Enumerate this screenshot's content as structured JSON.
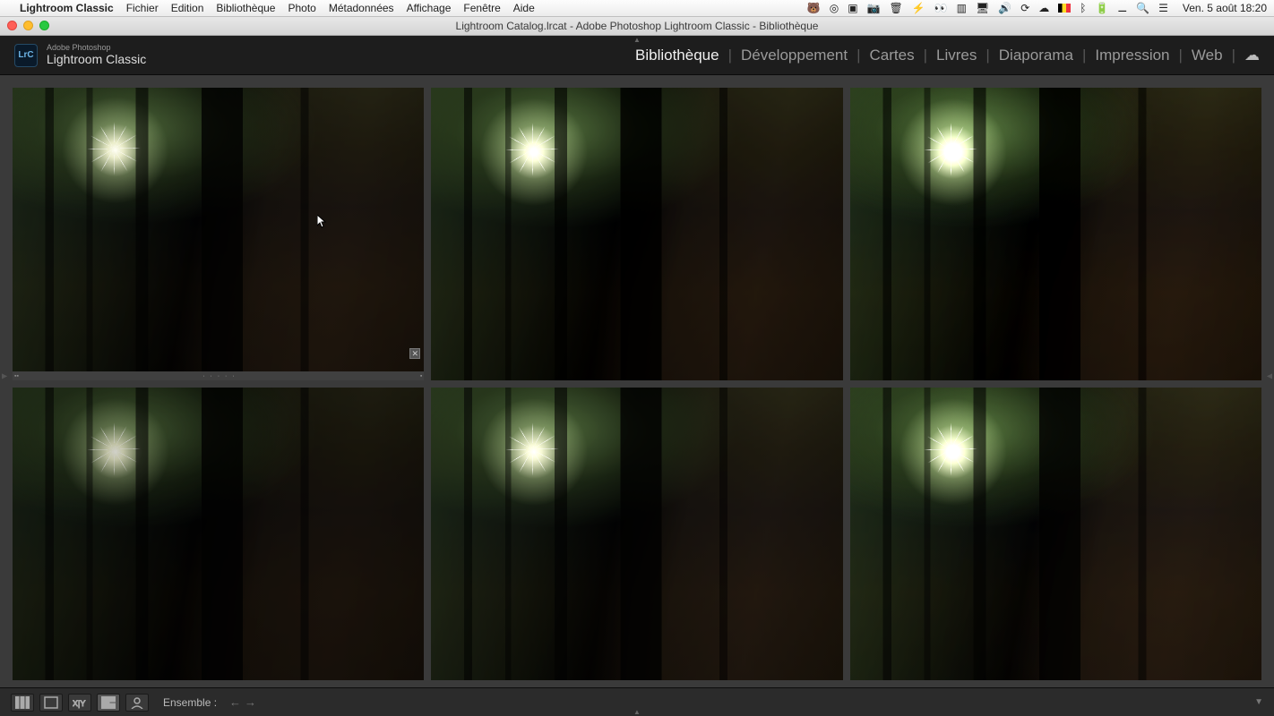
{
  "mac_menu": {
    "app": "Lightroom Classic",
    "items": [
      "Fichier",
      "Edition",
      "Bibliothèque",
      "Photo",
      "Métadonnées",
      "Affichage",
      "Fenêtre",
      "Aide"
    ],
    "clock": "Ven. 5 août  18:20"
  },
  "window": {
    "title": "Lightroom Catalog.lrcat - Adobe Photoshop Lightroom Classic - Bibliothèque"
  },
  "identity": {
    "small": "Adobe Photoshop",
    "big": "Lightroom Classic",
    "logo_text": "LrC"
  },
  "modules": [
    {
      "label": "Bibliothèque",
      "active": true
    },
    {
      "label": "Développement",
      "active": false
    },
    {
      "label": "Cartes",
      "active": false
    },
    {
      "label": "Livres",
      "active": false
    },
    {
      "label": "Diaporama",
      "active": false
    },
    {
      "label": "Impression",
      "active": false
    },
    {
      "label": "Web",
      "active": false
    }
  ],
  "grid": {
    "cells": [
      {
        "selected": true,
        "variant": "bright-0",
        "reject_badge": true
      },
      {
        "selected": false,
        "variant": "bright-1"
      },
      {
        "selected": false,
        "variant": "bright-2"
      },
      {
        "selected": false,
        "variant": "bright-3"
      },
      {
        "selected": false,
        "variant": "bright-4"
      },
      {
        "selected": false,
        "variant": "bright-5"
      }
    ],
    "footer_dots": "· · · · ·"
  },
  "toolbar": {
    "ensemble_label": "Ensemble :",
    "prev": "←",
    "next": "→"
  },
  "icons": {
    "status_right": [
      "bear-icon",
      "eye-icon",
      "record-icon",
      "camera-icon",
      "trash-icon",
      "flash-icon",
      "binoculars-icon",
      "panels-icon",
      "display-icon",
      "volume-icon",
      "sync-icon",
      "cloud-icon",
      "flag-be-icon",
      "bluetooth-icon",
      "battery-icon",
      "wifi-icon",
      "search-icon",
      "control-center-icon"
    ]
  }
}
